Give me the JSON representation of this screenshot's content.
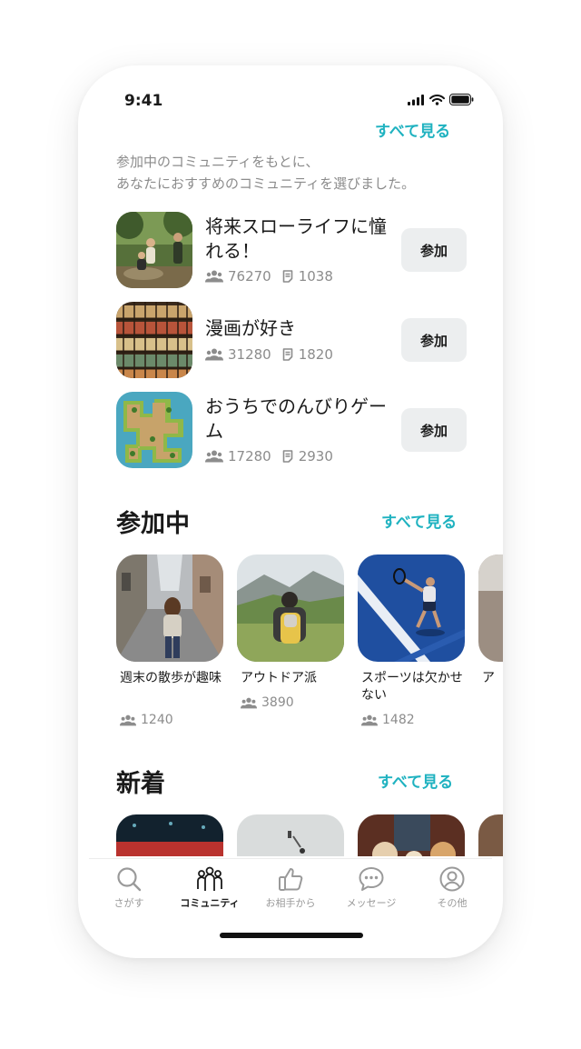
{
  "status_bar": {
    "time": "9:41"
  },
  "recommend": {
    "see_all": "すべて見る",
    "description_lines": [
      "参加中のコミュニティをもとに、",
      "あなたにおすすめのコミュニティを選びました。"
    ],
    "items": [
      {
        "title": "将来スローライフに憧れる！",
        "members": "76270",
        "posts": "1038",
        "button": "参加",
        "thumb": "people-outdoors-photo"
      },
      {
        "title": "漫画が好き",
        "members": "31280",
        "posts": "1820",
        "button": "参加",
        "thumb": "bookshelf-photo"
      },
      {
        "title": "おうちでのんびりゲーム",
        "members": "17280",
        "posts": "2930",
        "button": "参加",
        "thumb": "game-map-art"
      }
    ]
  },
  "joined": {
    "title": "参加中",
    "see_all": "すべて見る",
    "items": [
      {
        "name": "週末の散歩が趣味",
        "members": "1240",
        "thumb": "street-walk-photo"
      },
      {
        "name": "アウトドア派",
        "members": "3890",
        "thumb": "hiker-photo"
      },
      {
        "name": "スポーツは欠かせない",
        "members": "1482",
        "thumb": "tennis-photo"
      },
      {
        "name": "ア",
        "members": "",
        "thumb": "partial-photo"
      }
    ]
  },
  "new": {
    "title": "新着",
    "see_all": "すべて見る",
    "items": [
      {
        "thumb": "concert-photo"
      },
      {
        "thumb": "lamp-photo"
      },
      {
        "thumb": "bakery-photo"
      }
    ]
  },
  "tabbar": {
    "tabs": [
      {
        "label": "さがす",
        "icon": "search-icon",
        "active": false
      },
      {
        "label": "コミュニティ",
        "icon": "community-icon",
        "active": true
      },
      {
        "label": "お相手から",
        "icon": "thumbs-up-icon",
        "active": false
      },
      {
        "label": "メッセージ",
        "icon": "chat-bubble-icon",
        "active": false
      },
      {
        "label": "その他",
        "icon": "user-circle-icon",
        "active": false
      }
    ]
  },
  "colors": {
    "accent": "#1fb2c0",
    "text": "#1a1a1a",
    "muted": "#8c8c8c",
    "button_bg": "#eceeef"
  }
}
